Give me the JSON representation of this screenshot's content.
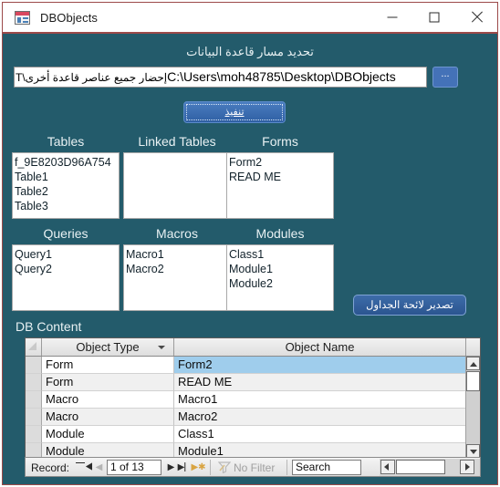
{
  "window": {
    "title": "DBObjects",
    "icon": "access-form-icon",
    "controls": {
      "minimize": "minimize-icon",
      "maximize": "maximize-icon",
      "close": "close-icon"
    }
  },
  "path_section": {
    "label": "تحديد مسار قاعدة البيانات",
    "value_ltr": "C:\\Users\\moh48785\\Desktop\\DBObjects",
    "value_rtl": "إحضار جميع عناصر قاعدة أخرى\\T",
    "browse_label": "...",
    "execute_label": "تنفيذ"
  },
  "lists": [
    {
      "key": "tables",
      "caption": "Tables",
      "items": [
        "f_9E8203D96A754",
        "Table1",
        "Table2",
        "Table3"
      ]
    },
    {
      "key": "linked_tables",
      "caption": "Linked Tables",
      "items": []
    },
    {
      "key": "forms",
      "caption": "Forms",
      "items": [
        "Form2",
        "READ ME"
      ]
    },
    {
      "key": "queries",
      "caption": "Queries",
      "items": [
        "Query1",
        "Query2"
      ]
    },
    {
      "key": "macros",
      "caption": "Macros",
      "items": [
        "Macro1",
        "Macro2"
      ]
    },
    {
      "key": "modules",
      "caption": "Modules",
      "items": [
        "Class1",
        "Module1",
        "Module2"
      ]
    }
  ],
  "export_button": {
    "label": "تصدير لائحة الجداول"
  },
  "db_content": {
    "label": "DB Content",
    "columns": [
      "Object Type",
      "Object Name"
    ],
    "rows": [
      {
        "type": "Form",
        "name": "Form2",
        "selected": true
      },
      {
        "type": "Form",
        "name": "READ ME",
        "selected": false
      },
      {
        "type": "Macro",
        "name": "Macro1",
        "selected": false
      },
      {
        "type": "Macro",
        "name": "Macro2",
        "selected": false
      },
      {
        "type": "Module",
        "name": "Class1",
        "selected": false
      },
      {
        "type": "Module",
        "name": "Module1",
        "selected": false
      }
    ]
  },
  "navigator": {
    "record_label": "Record:",
    "position": "1 of 13",
    "first_icon": "first-record-icon",
    "prev_icon": "previous-record-icon",
    "next_icon": "next-record-icon",
    "last_icon": "last-record-icon",
    "new_icon": "new-record-icon",
    "filter_icon": "filter-icon",
    "filter_text": "No Filter",
    "search_value": "Search"
  },
  "colors": {
    "form_background": "#235b6b",
    "frame_border": "#9c4a4a",
    "selection": "#9fcdec",
    "button_blue": "#3d6ca9"
  }
}
